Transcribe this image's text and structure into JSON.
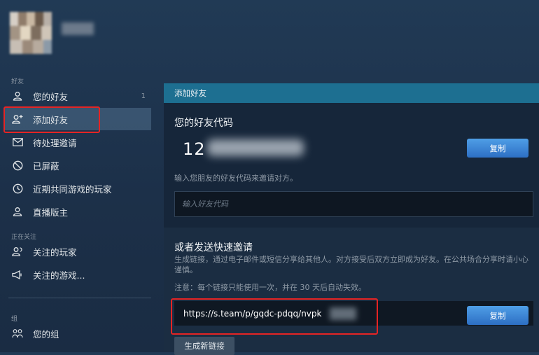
{
  "sidebar": {
    "section_friends": "好友",
    "friends_count": "1",
    "section_following": "正在关注",
    "section_groups": "组",
    "items": [
      {
        "label": "您的好友",
        "icon": "user-icon"
      },
      {
        "label": "添加好友",
        "icon": "user-plus-icon",
        "active": true
      },
      {
        "label": "待处理邀请",
        "icon": "envelope-icon"
      },
      {
        "label": "已屏蔽",
        "icon": "blocked-icon"
      },
      {
        "label": "近期共同游戏的玩家",
        "icon": "clock-icon"
      },
      {
        "label": "直播版主",
        "icon": "user-icon"
      },
      {
        "label": "关注的玩家",
        "icon": "user-follow-icon"
      },
      {
        "label": "关注的游戏...",
        "icon": "megaphone-icon"
      },
      {
        "label": "您的组",
        "icon": "group-icon"
      }
    ]
  },
  "main": {
    "tab_title": "添加好友",
    "friend_code": {
      "heading": "您的好友代码",
      "code_prefix": "12",
      "copy_label": "复制",
      "hint": "输入您朋友的好友代码来邀请对方。",
      "input_placeholder": "输入好友代码"
    },
    "quick_invite": {
      "heading": "或者发送快速邀请",
      "description": "生成链接，通过电子邮件或短信分享给其他人。对方接受后双方立即成为好友。在公共场合分享时请小心谨慎。",
      "note": "注意：每个链接只能使用一次，并在 30 天后自动失效。",
      "link": "https://s.team/p/gqdc-pdqq/nvpk",
      "copy_label": "复制",
      "generate_label": "生成新链接"
    }
  },
  "colors": {
    "accent_blue": "#2d6fc4",
    "tab_bar": "#1d6f91",
    "highlight_red": "#e52424",
    "active_item": "#4f6f8e"
  }
}
